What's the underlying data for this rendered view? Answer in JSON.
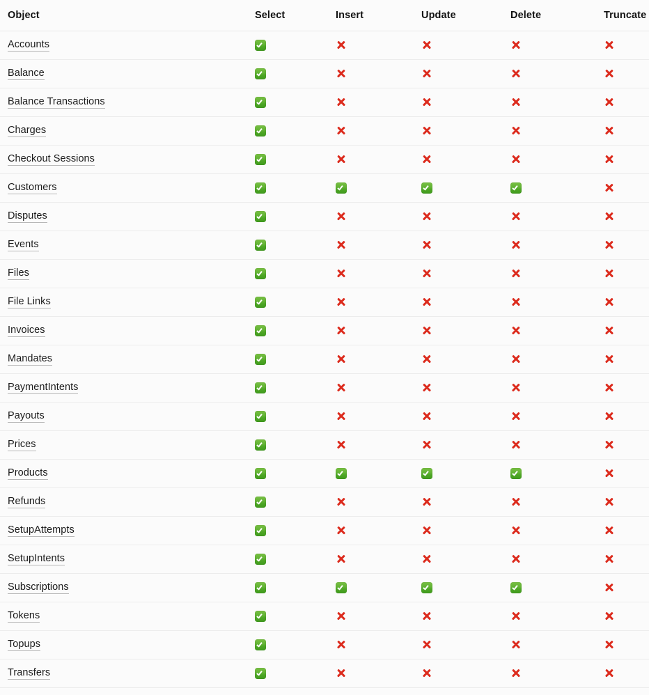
{
  "table": {
    "columns": [
      {
        "key": "object",
        "label": "Object",
        "icon": null
      },
      {
        "key": "select",
        "label": "Select",
        "icon": null
      },
      {
        "key": "insert",
        "label": "Insert",
        "icon": null
      },
      {
        "key": "update",
        "label": "Update",
        "icon": null
      },
      {
        "key": "delete",
        "label": "Delete",
        "icon": null
      },
      {
        "key": "truncate",
        "label": "Truncate",
        "icon": null
      }
    ],
    "icons": {
      "allowed": "check-mark-green-icon",
      "denied": "cross-mark-red-icon"
    },
    "colors": {
      "check_green_top": "#78c043",
      "check_green_bottom": "#3f9a1d",
      "cross_red": "#dc2b1d",
      "background": "#fbfbfb",
      "row_border": "#ececec",
      "header_border": "#e8e8e8",
      "text": "#1b1b1b",
      "link_underline": "#b7b7b7"
    },
    "rows": [
      {
        "object": "Accounts",
        "select": true,
        "insert": false,
        "update": false,
        "delete": false,
        "truncate": false
      },
      {
        "object": "Balance",
        "select": true,
        "insert": false,
        "update": false,
        "delete": false,
        "truncate": false
      },
      {
        "object": "Balance Transactions",
        "select": true,
        "insert": false,
        "update": false,
        "delete": false,
        "truncate": false
      },
      {
        "object": "Charges",
        "select": true,
        "insert": false,
        "update": false,
        "delete": false,
        "truncate": false
      },
      {
        "object": "Checkout Sessions",
        "select": true,
        "insert": false,
        "update": false,
        "delete": false,
        "truncate": false
      },
      {
        "object": "Customers",
        "select": true,
        "insert": true,
        "update": true,
        "delete": true,
        "truncate": false
      },
      {
        "object": "Disputes",
        "select": true,
        "insert": false,
        "update": false,
        "delete": false,
        "truncate": false
      },
      {
        "object": "Events",
        "select": true,
        "insert": false,
        "update": false,
        "delete": false,
        "truncate": false
      },
      {
        "object": "Files",
        "select": true,
        "insert": false,
        "update": false,
        "delete": false,
        "truncate": false
      },
      {
        "object": "File Links",
        "select": true,
        "insert": false,
        "update": false,
        "delete": false,
        "truncate": false
      },
      {
        "object": "Invoices",
        "select": true,
        "insert": false,
        "update": false,
        "delete": false,
        "truncate": false
      },
      {
        "object": "Mandates",
        "select": true,
        "insert": false,
        "update": false,
        "delete": false,
        "truncate": false
      },
      {
        "object": "PaymentIntents",
        "select": true,
        "insert": false,
        "update": false,
        "delete": false,
        "truncate": false
      },
      {
        "object": "Payouts",
        "select": true,
        "insert": false,
        "update": false,
        "delete": false,
        "truncate": false
      },
      {
        "object": "Prices",
        "select": true,
        "insert": false,
        "update": false,
        "delete": false,
        "truncate": false
      },
      {
        "object": "Products",
        "select": true,
        "insert": true,
        "update": true,
        "delete": true,
        "truncate": false
      },
      {
        "object": "Refunds",
        "select": true,
        "insert": false,
        "update": false,
        "delete": false,
        "truncate": false
      },
      {
        "object": "SetupAttempts",
        "select": true,
        "insert": false,
        "update": false,
        "delete": false,
        "truncate": false
      },
      {
        "object": "SetupIntents",
        "select": true,
        "insert": false,
        "update": false,
        "delete": false,
        "truncate": false
      },
      {
        "object": "Subscriptions",
        "select": true,
        "insert": true,
        "update": true,
        "delete": true,
        "truncate": false
      },
      {
        "object": "Tokens",
        "select": true,
        "insert": false,
        "update": false,
        "delete": false,
        "truncate": false
      },
      {
        "object": "Topups",
        "select": true,
        "insert": false,
        "update": false,
        "delete": false,
        "truncate": false
      },
      {
        "object": "Transfers",
        "select": true,
        "insert": false,
        "update": false,
        "delete": false,
        "truncate": false
      }
    ]
  }
}
